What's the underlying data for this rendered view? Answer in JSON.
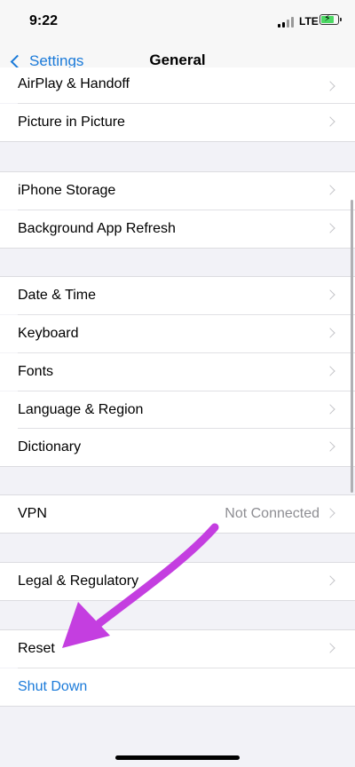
{
  "status_bar": {
    "time": "9:22",
    "network": "LTE"
  },
  "nav": {
    "back_label": "Settings",
    "title": "General"
  },
  "groups": [
    {
      "items": [
        {
          "label": "AirPlay & Handoff"
        },
        {
          "label": "Picture in Picture"
        }
      ]
    },
    {
      "items": [
        {
          "label": "iPhone Storage"
        },
        {
          "label": "Background App Refresh"
        }
      ]
    },
    {
      "items": [
        {
          "label": "Date & Time"
        },
        {
          "label": "Keyboard"
        },
        {
          "label": "Fonts"
        },
        {
          "label": "Language & Region"
        },
        {
          "label": "Dictionary"
        }
      ]
    },
    {
      "items": [
        {
          "label": "VPN",
          "detail": "Not Connected"
        }
      ]
    },
    {
      "items": [
        {
          "label": "Legal & Regulatory"
        }
      ]
    },
    {
      "items": [
        {
          "label": "Reset"
        },
        {
          "label": "Shut Down"
        }
      ]
    }
  ],
  "colors": {
    "link": "#1a7ad9",
    "annotation_arrow": "#c43ee0",
    "battery": "#4cd964"
  },
  "annotation": {
    "type": "arrow",
    "points_to": "Reset"
  }
}
